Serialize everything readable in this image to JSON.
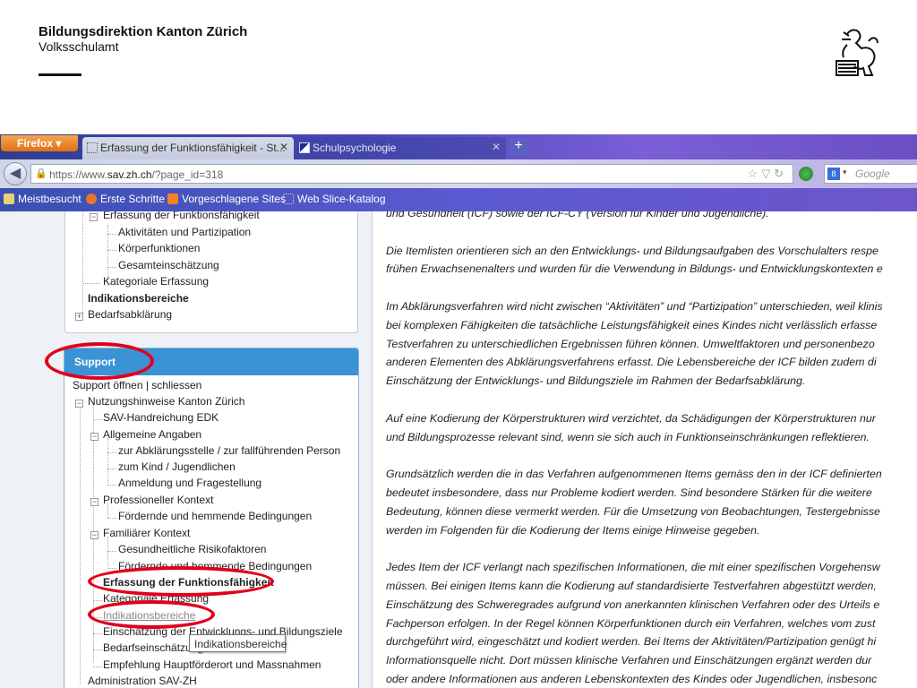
{
  "slide": {
    "org_title": "Bildungsdirektion Kanton Zürich",
    "org_subtitle": "Volksschulamt"
  },
  "browser": {
    "firefox_button": "Firefox",
    "tabs": [
      {
        "label": "Erfassung der Funktionsfähigkeit - St...",
        "active": true
      },
      {
        "label": "Schulpsychologie",
        "active": false
      }
    ],
    "url_prefix": "https://www.",
    "url_domain": "sav.zh.ch",
    "url_suffix": "/?page_id=318",
    "search_placeholder": "Google",
    "bookmarks": [
      "Meistbesucht",
      "Erste Schritte",
      "Vorgeschlagene Sites",
      "Web Slice-Katalog"
    ]
  },
  "nav_box": {
    "items": [
      "Erfassung der Funktionsfähigkeit",
      "Aktivitäten und Partizipation",
      "Körperfunktionen",
      "Gesamteinschätzung",
      "Kategoriale Erfassung",
      "Indikationsbereiche",
      "Bedarfsabklärung"
    ]
  },
  "support_box": {
    "title": "Support",
    "controls": "Support öffnen | schliessen",
    "items": [
      "Nutzungshinweise Kanton Zürich",
      "SAV-Handreichung EDK",
      "Allgemeine Angaben",
      "zur Abklärungsstelle / zur fallführenden Person",
      "zum Kind / Jugendlichen",
      "Anmeldung und Fragestellung",
      "Professioneller Kontext",
      "Fördernde und hemmende Bedingungen",
      "Familiärer Kontext",
      "Gesundheitliche Risikofaktoren",
      "Fördernde und hemmende Bedingungen",
      "Erfassung der Funktionsfähigkeit",
      "Kategoriale Erfassung",
      "Indikationsbereiche",
      "Einschätzung der Entwicklungs- und Bildungsziele",
      "Bedarfseinschätzung",
      "Empfehlung Hauptförderort und Massnahmen",
      "Administration SAV-ZH"
    ],
    "tooltip": "Indikationsbereiche"
  },
  "article": {
    "lines": [
      "und Gesundheit (ICF) sowie der ICF-CY (Version für Kinder und Jugendliche).",
      "",
      "Die Itemlisten orientieren sich an den Entwicklungs- und Bildungsaufgaben des Vorschulalters respe",
      "frühen Erwachsenenalters und wurden für die Verwendung in Bildungs- und Entwicklungskontexten e",
      "",
      "Im Abklärungsverfahren wird nicht zwischen “Aktivitäten” und “Partizipation” unterschieden, weil klinis",
      "bei komplexen Fähigkeiten die tatsächliche Leistungsfähigkeit eines Kindes nicht verlässlich erfasse",
      "Testverfahren zu unterschiedlichen Ergebnissen führen können. Umweltfaktoren und personenbezo",
      "anderen Elementen des Abklärungsverfahrens erfasst. Die Lebensbereiche der ICF bilden zudem di",
      "Einschätzung der Entwicklungs- und Bildungsziele im Rahmen der Bedarfsabklärung.",
      "",
      "Auf eine Kodierung der Körperstrukturen wird verzichtet, da Schädigungen der Körperstrukturen nur",
      "und Bildungsprozesse relevant sind, wenn sie sich auch in Funktionseinschränkungen reflektieren.",
      "",
      "Grundsätzlich werden die in das Verfahren aufgenommenen Items gemäss den in der ICF definierten",
      "bedeutet insbesondere, dass nur Probleme kodiert werden. Sind besondere Stärken für die weitere",
      "Bedeutung, können diese vermerkt werden. Für die Umsetzung von Beobachtungen, Testergebnisse",
      "werden im Folgenden für die Kodierung der Items einige Hinweise gegeben.",
      "",
      "Jedes Item der ICF verlangt nach spezifischen Informationen, die mit einer spezifischen Vorgehensw",
      "müssen. Bei einigen Items kann die Kodierung auf standardisierte Testverfahren abgestützt werden,",
      "Einschätzung des Schweregrades aufgrund von anerkannten klinischen Verfahren oder des Urteils e",
      "Fachperson erfolgen. In der Regel können Körperfunktionen durch ein Verfahren, welches vom zust",
      "durchgeführt wird, eingeschätzt und kodiert werden. Bei Items der Aktivitäten/Partizipation genügt hi",
      "Informationsquelle nicht. Dort müssen klinische Verfahren und Einschätzungen ergänzt werden dur",
      "oder andere Informationen aus anderen Lebenskontexten des Kindes oder Jugendlichen, insbesonc"
    ]
  },
  "colors": {
    "accent_blue": "#3a93d4",
    "annotation_red": "#e0001b",
    "firefox_orange": "#e0701a"
  }
}
